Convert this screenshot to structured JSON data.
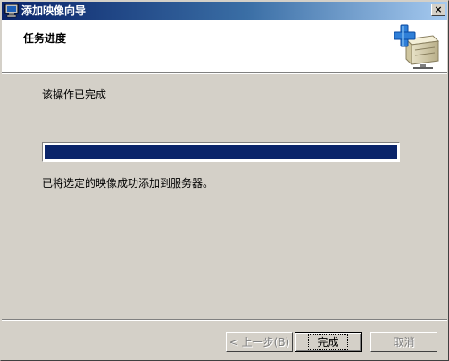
{
  "window": {
    "title": "添加映像向导",
    "close_label": "×"
  },
  "header": {
    "title": "任务进度"
  },
  "main": {
    "status": "该操作已完成",
    "progress_percent": 100,
    "result": "已将选定的映像成功添加到服务器。"
  },
  "buttons": {
    "back": "< 上一步(B)",
    "finish": "完成",
    "cancel": "取消"
  },
  "colors": {
    "titlebar_start": "#0a246a",
    "titlebar_end": "#a6caf0",
    "progress_fill": "#0a246a",
    "dialog_bg": "#d4d0c8"
  }
}
